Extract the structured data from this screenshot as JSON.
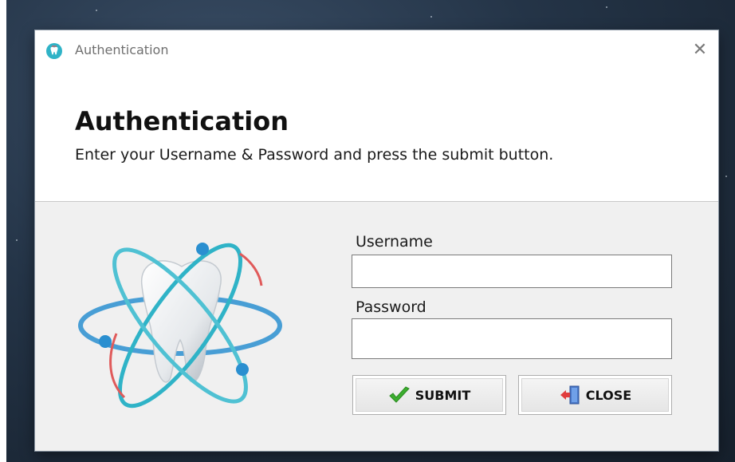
{
  "window": {
    "title": "Authentication",
    "app_icon": "tooth-icon",
    "close_icon": "close-icon",
    "close_glyph": "✕"
  },
  "header": {
    "heading": "Authentication",
    "subheading": "Enter your Username & Password and press the submit button."
  },
  "form": {
    "username_label": "Username",
    "username_value": "",
    "password_label": "Password",
    "password_value": ""
  },
  "buttons": {
    "submit_label": "SUBMIT",
    "submit_icon": "checkmark-icon",
    "close_label": "CLOSE",
    "close_icon": "exit-door-icon"
  },
  "colors": {
    "accent_teal": "#2fb3c7",
    "orbit_blue": "#2a8fd0",
    "checkmark_green": "#3cae2f",
    "exit_red": "#e03c3c"
  }
}
